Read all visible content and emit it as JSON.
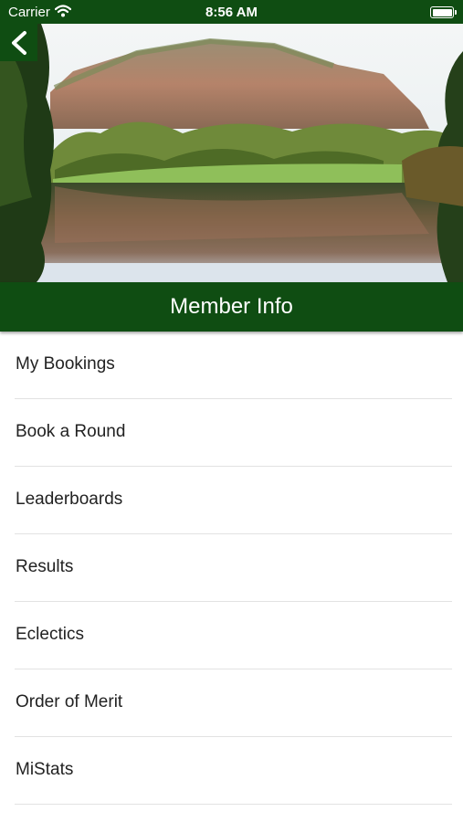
{
  "status_bar": {
    "carrier": "Carrier",
    "time": "8:56 AM"
  },
  "header": {
    "title": "Member Info"
  },
  "menu": {
    "items": [
      {
        "label": "My Bookings"
      },
      {
        "label": "Book a Round"
      },
      {
        "label": "Leaderboards"
      },
      {
        "label": "Results"
      },
      {
        "label": "Eclectics"
      },
      {
        "label": "Order of Merit"
      },
      {
        "label": "MiStats"
      }
    ]
  },
  "colors": {
    "brand_green": "#0f4d12",
    "divider": "#e2e2e2",
    "text": "#222222"
  },
  "icons": {
    "back": "chevron-left-icon",
    "wifi": "wifi-icon",
    "battery": "battery-icon"
  }
}
